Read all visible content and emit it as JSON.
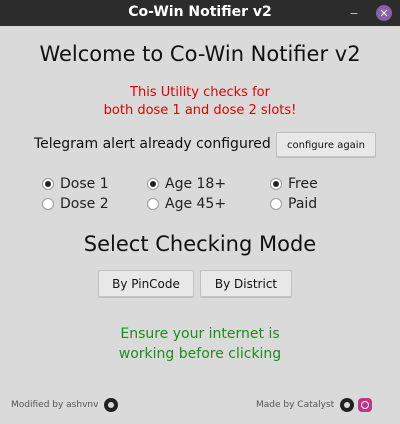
{
  "window": {
    "title": "Co-Win Notifier v2",
    "close_glyph": "✕",
    "minimize_glyph": "−"
  },
  "heading": "Welcome to Co-Win Notifier v2",
  "info": {
    "line1": "This Utility checks for",
    "line2": "both dose 1 and dose 2 slots!"
  },
  "telegram": {
    "label": "Telegram alert already configured",
    "button": "configure again"
  },
  "options": {
    "dose": [
      {
        "label": "Dose 1",
        "selected": true
      },
      {
        "label": "Dose 2",
        "selected": false
      }
    ],
    "age": [
      {
        "label": "Age 18+",
        "selected": true
      },
      {
        "label": "Age 45+",
        "selected": false
      }
    ],
    "fee": [
      {
        "label": "Free",
        "selected": true
      },
      {
        "label": "Paid",
        "selected": false
      }
    ]
  },
  "mode": {
    "heading": "Select Checking Mode",
    "pincode_button": "By PinCode",
    "district_button": "By District"
  },
  "warning": {
    "line1": "Ensure your internet is",
    "line2": "working before clicking"
  },
  "footer": {
    "left": "Modified by ashvnv",
    "right": "Made by Catalyst"
  },
  "colors": {
    "info": "#e00000",
    "warning": "#1e8c1e",
    "titlebar": "#2c2c2c",
    "background": "#dadada"
  },
  "icons": [
    "github-icon",
    "instagram-icon"
  ]
}
